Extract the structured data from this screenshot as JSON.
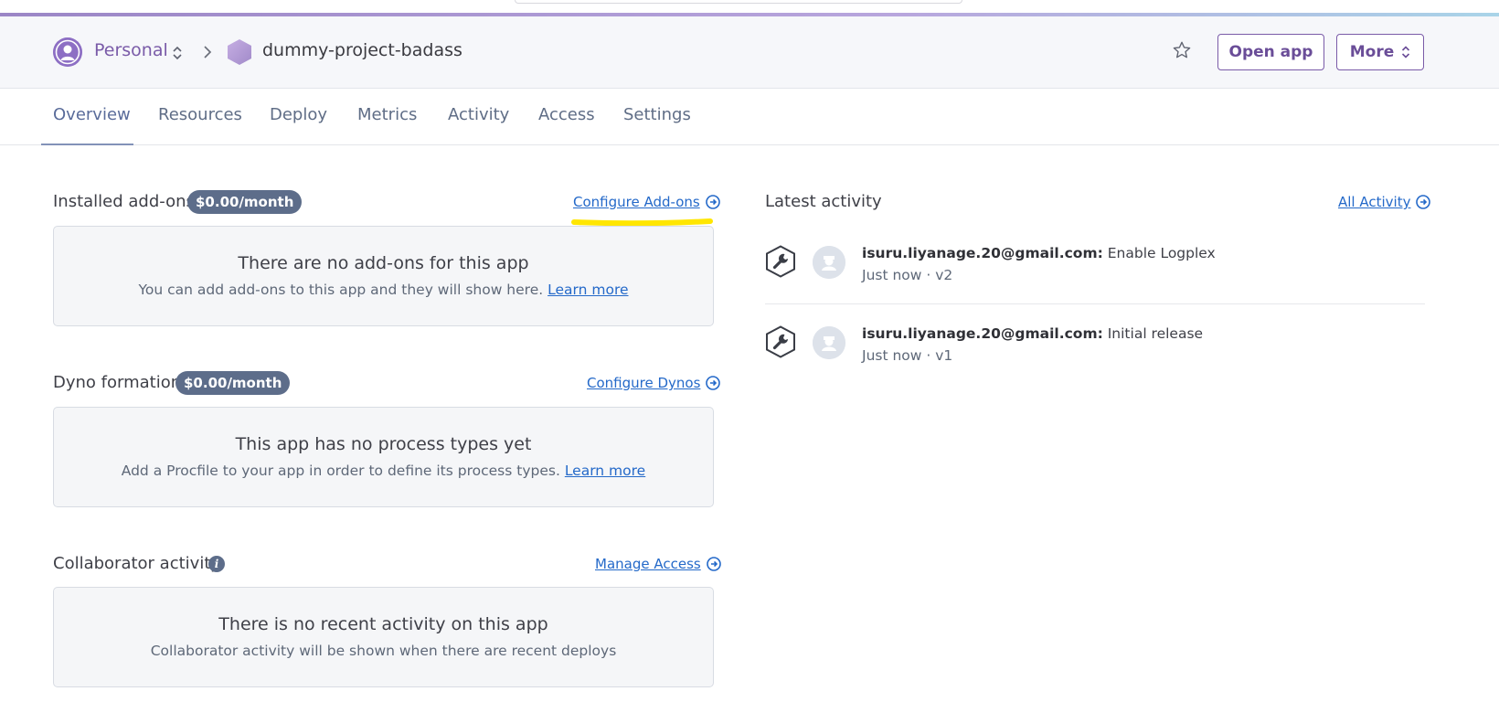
{
  "header": {
    "account_label": "Personal",
    "project_name": "dummy-project-badass",
    "open_app_label": "Open app",
    "more_label": "More"
  },
  "tabs": [
    {
      "label": "Overview",
      "active": true
    },
    {
      "label": "Resources"
    },
    {
      "label": "Deploy"
    },
    {
      "label": "Metrics"
    },
    {
      "label": "Activity"
    },
    {
      "label": "Access"
    },
    {
      "label": "Settings"
    }
  ],
  "addons": {
    "title": "Installed add-ons",
    "price": "$0.00/month",
    "link": "Configure Add-ons",
    "empty_title": "There are no add-ons for this app",
    "empty_text": "You can add add-ons to this app and they will show here.",
    "learn_more": "Learn more"
  },
  "dynos": {
    "title": "Dyno formation",
    "price": "$0.00/month",
    "link": "Configure Dynos",
    "empty_title": "This app has no process types yet",
    "empty_text": "Add a Procfile to your app in order to define its process types.",
    "learn_more": "Learn more"
  },
  "collaborators": {
    "title": "Collaborator activity",
    "link": "Manage Access",
    "empty_title": "There is no recent activity on this app",
    "empty_text": "Collaborator activity will be shown when there are recent deploys"
  },
  "latest_activity": {
    "title": "Latest activity",
    "link": "All Activity",
    "items": [
      {
        "user": "isuru.liyanage.20@gmail.com:",
        "action": "Enable Logplex",
        "meta": "Just now · v2"
      },
      {
        "user": "isuru.liyanage.20@gmail.com:",
        "action": "Initial release",
        "meta": "Just now · v1"
      }
    ]
  },
  "icons": {
    "avatar": "user-avatar-icon",
    "project": "hexagon-icon",
    "favorite": "star-icon",
    "link_arrow": "circle-arrow-right-icon",
    "activity": "wrench-icon",
    "info": "info-icon"
  },
  "colors": {
    "accent_purple": "#7a5ba8",
    "link_blue": "#2469c9",
    "badge": "#5d6d8a",
    "highlight_marker": "#ffe600"
  }
}
